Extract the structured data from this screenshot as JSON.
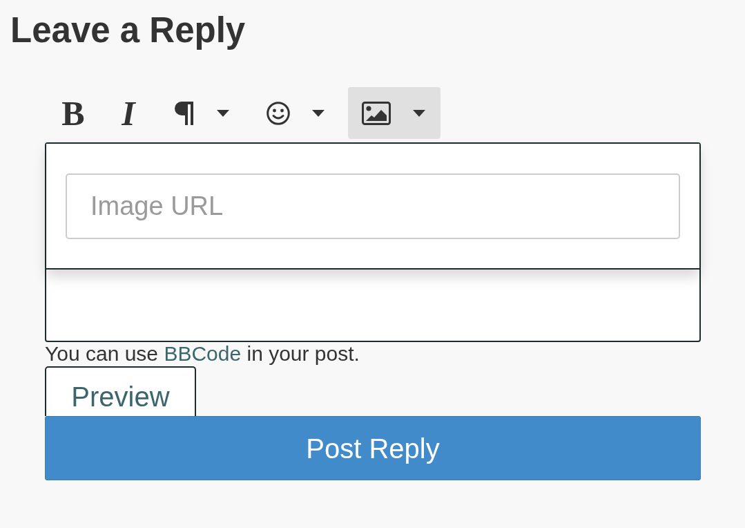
{
  "heading": "Leave a Reply",
  "toolbar": [
    {
      "kind": "bold",
      "label": "B",
      "dropdown": false,
      "selected": false
    },
    {
      "kind": "italic",
      "label": "I",
      "dropdown": false,
      "selected": false
    },
    {
      "kind": "paragraph",
      "dropdown": true,
      "selected": false
    },
    {
      "kind": "emoji",
      "dropdown": true,
      "selected": false
    },
    {
      "kind": "image",
      "dropdown": true,
      "selected": true
    }
  ],
  "editor": {
    "popup": {
      "placeholder": "Image URL"
    }
  },
  "help_text": {
    "before": "You can use ",
    "link": "BBCode",
    "after": " in your post."
  },
  "preview_button": "Preview",
  "submit_button": "Post Reply"
}
